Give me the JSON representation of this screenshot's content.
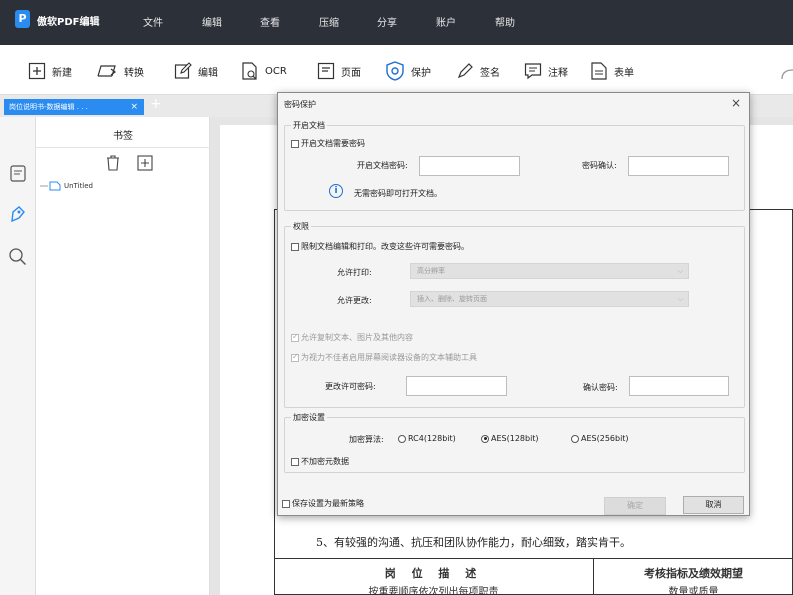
{
  "app": {
    "logo_letter": "P",
    "name": "傲软PDF编辑",
    "menu": [
      "文件",
      "编辑",
      "查看",
      "压缩",
      "分享",
      "账户",
      "帮助"
    ]
  },
  "toolbar": {
    "new_label": "新建",
    "convert_label": "转换",
    "edit_label": "编辑",
    "ocr_label": "OCR",
    "page_label": "页面",
    "protect_label": "保护",
    "sign_label": "签名",
    "annotate_label": "注释",
    "form_label": "表单"
  },
  "tab": {
    "title": "岗位说明书-数据编辑 . . .",
    "close": "×",
    "add": "+"
  },
  "bookmarks": {
    "title": "书签",
    "item_label": "UnTitled"
  },
  "document": {
    "line5": "5、有较强的沟通、抗压和团队协作能力，耐心细致，踏实肯干。",
    "job_title": "岗 位 描 述",
    "job_subtitle": "按重要顺序依次列出每项职责",
    "kpi_title": "考核指标及绩效期望",
    "kpi_subtitle": "数量或质量"
  },
  "dialog": {
    "title": "密码保护",
    "close": "×",
    "open_group": {
      "title": "开启文档",
      "require_pw_label": "开启文档需要密码",
      "pw_label": "开启文档密码:",
      "confirm_label": "密码确认:",
      "info_text": "无需密码即可打开文档。"
    },
    "perm_group": {
      "title": "权限",
      "restrict_label": "限制文档编辑和打印。改变这些许可需要密码。",
      "print_label": "允许打印:",
      "print_value": "高分辨率",
      "change_label": "允许更改:",
      "change_value": "插入、删除、旋转页面",
      "copy_label": "允许复制文本、图片及其他内容",
      "screen_reader_label": "为视力不佳者启用屏幕阅读器设备的文本辅助工具",
      "perm_pw_label": "更改许可密码:",
      "confirm_label": "确认密码:"
    },
    "enc_group": {
      "title": "加密设置",
      "algo_label": "加密算法:",
      "options": [
        "RC4(128bit)",
        "AES(128bit)",
        "AES(256bit)"
      ],
      "selected": "AES(128bit)",
      "no_meta_label": "不加密元数据"
    },
    "save_default_label": "保存设置为最新策略",
    "ok_label": "确定",
    "cancel_label": "取消"
  },
  "colors": {
    "titlebar": "#2c3038",
    "accent": "#2a8cf0",
    "protect_icon": "#1d6fd0"
  }
}
